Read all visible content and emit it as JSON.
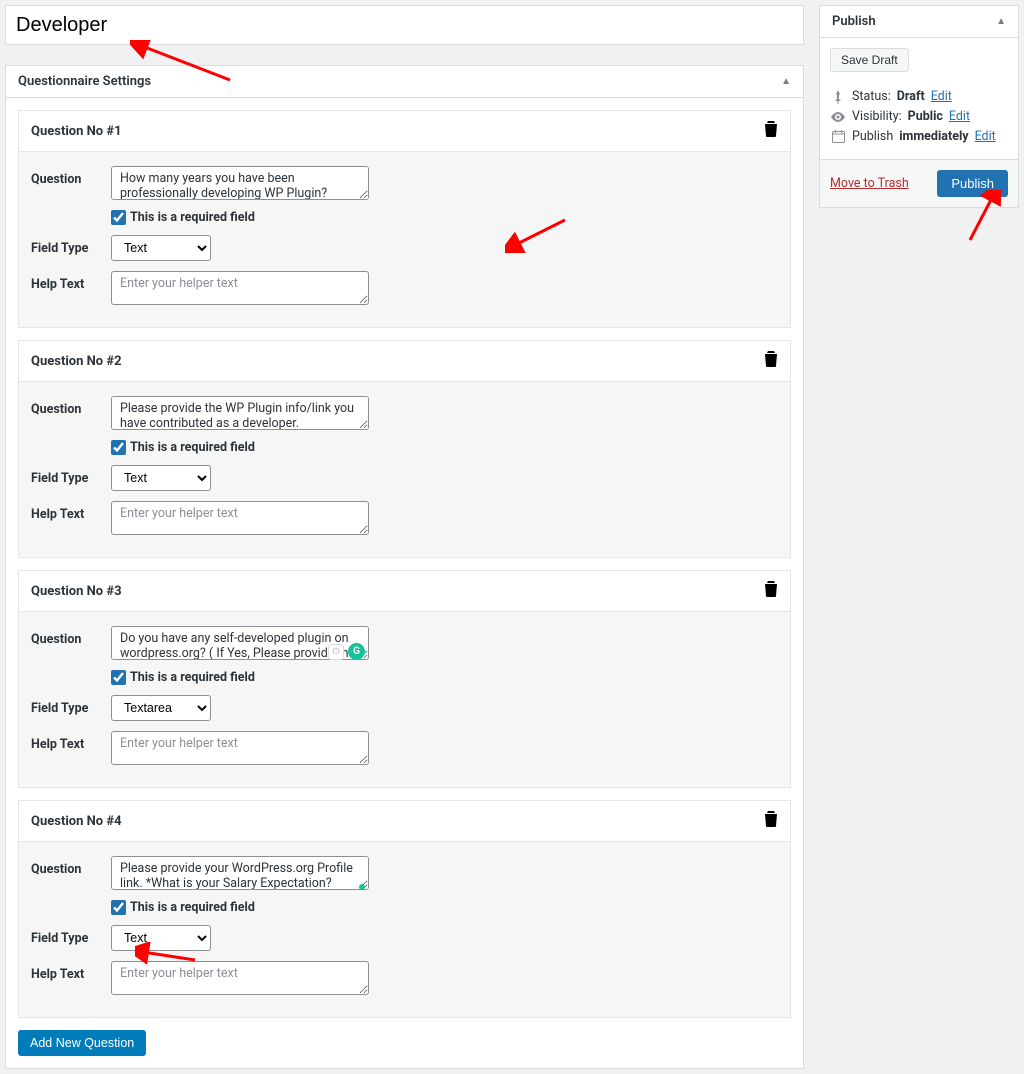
{
  "title": "Developer",
  "settings_panel_title": "Questionnaire Settings",
  "help_placeholder": "Enter your helper text",
  "required_label": "This is a required field",
  "labels": {
    "question": "Question",
    "field_type": "Field Type",
    "help_text": "Help Text"
  },
  "add_btn": "Add New Question",
  "questions": [
    {
      "header": "Question No #1",
      "text": "How many years you have been professionally developing WP Plugin?",
      "required": true,
      "field_type": "Text",
      "help_text": ""
    },
    {
      "header": "Question No #2",
      "text": "Please provide the WP Plugin info/link you have contributed as a developer.",
      "required": true,
      "field_type": "Text",
      "help_text": ""
    },
    {
      "header": "Question No #3",
      "text": "Do you have any self-developed plugin on wordpress.org? ( If Yes, Please provide the link )",
      "required": true,
      "field_type": "Textarea",
      "help_text": ""
    },
    {
      "header": "Question No #4",
      "text": "Please provide your WordPress.org Profile link. *What is your Salary Expectation?",
      "required": true,
      "field_type": "Text",
      "help_text": ""
    }
  ],
  "field_type_options": [
    "Text",
    "Textarea"
  ],
  "publish": {
    "panel_title": "Publish",
    "save_draft": "Save Draft",
    "status_label": "Status:",
    "status_value": "Draft",
    "visibility_label": "Visibility:",
    "visibility_value": "Public",
    "publish_label": "Publish",
    "publish_value": "immediately",
    "edit": "Edit",
    "trash": "Move to Trash",
    "publish_btn": "Publish"
  }
}
